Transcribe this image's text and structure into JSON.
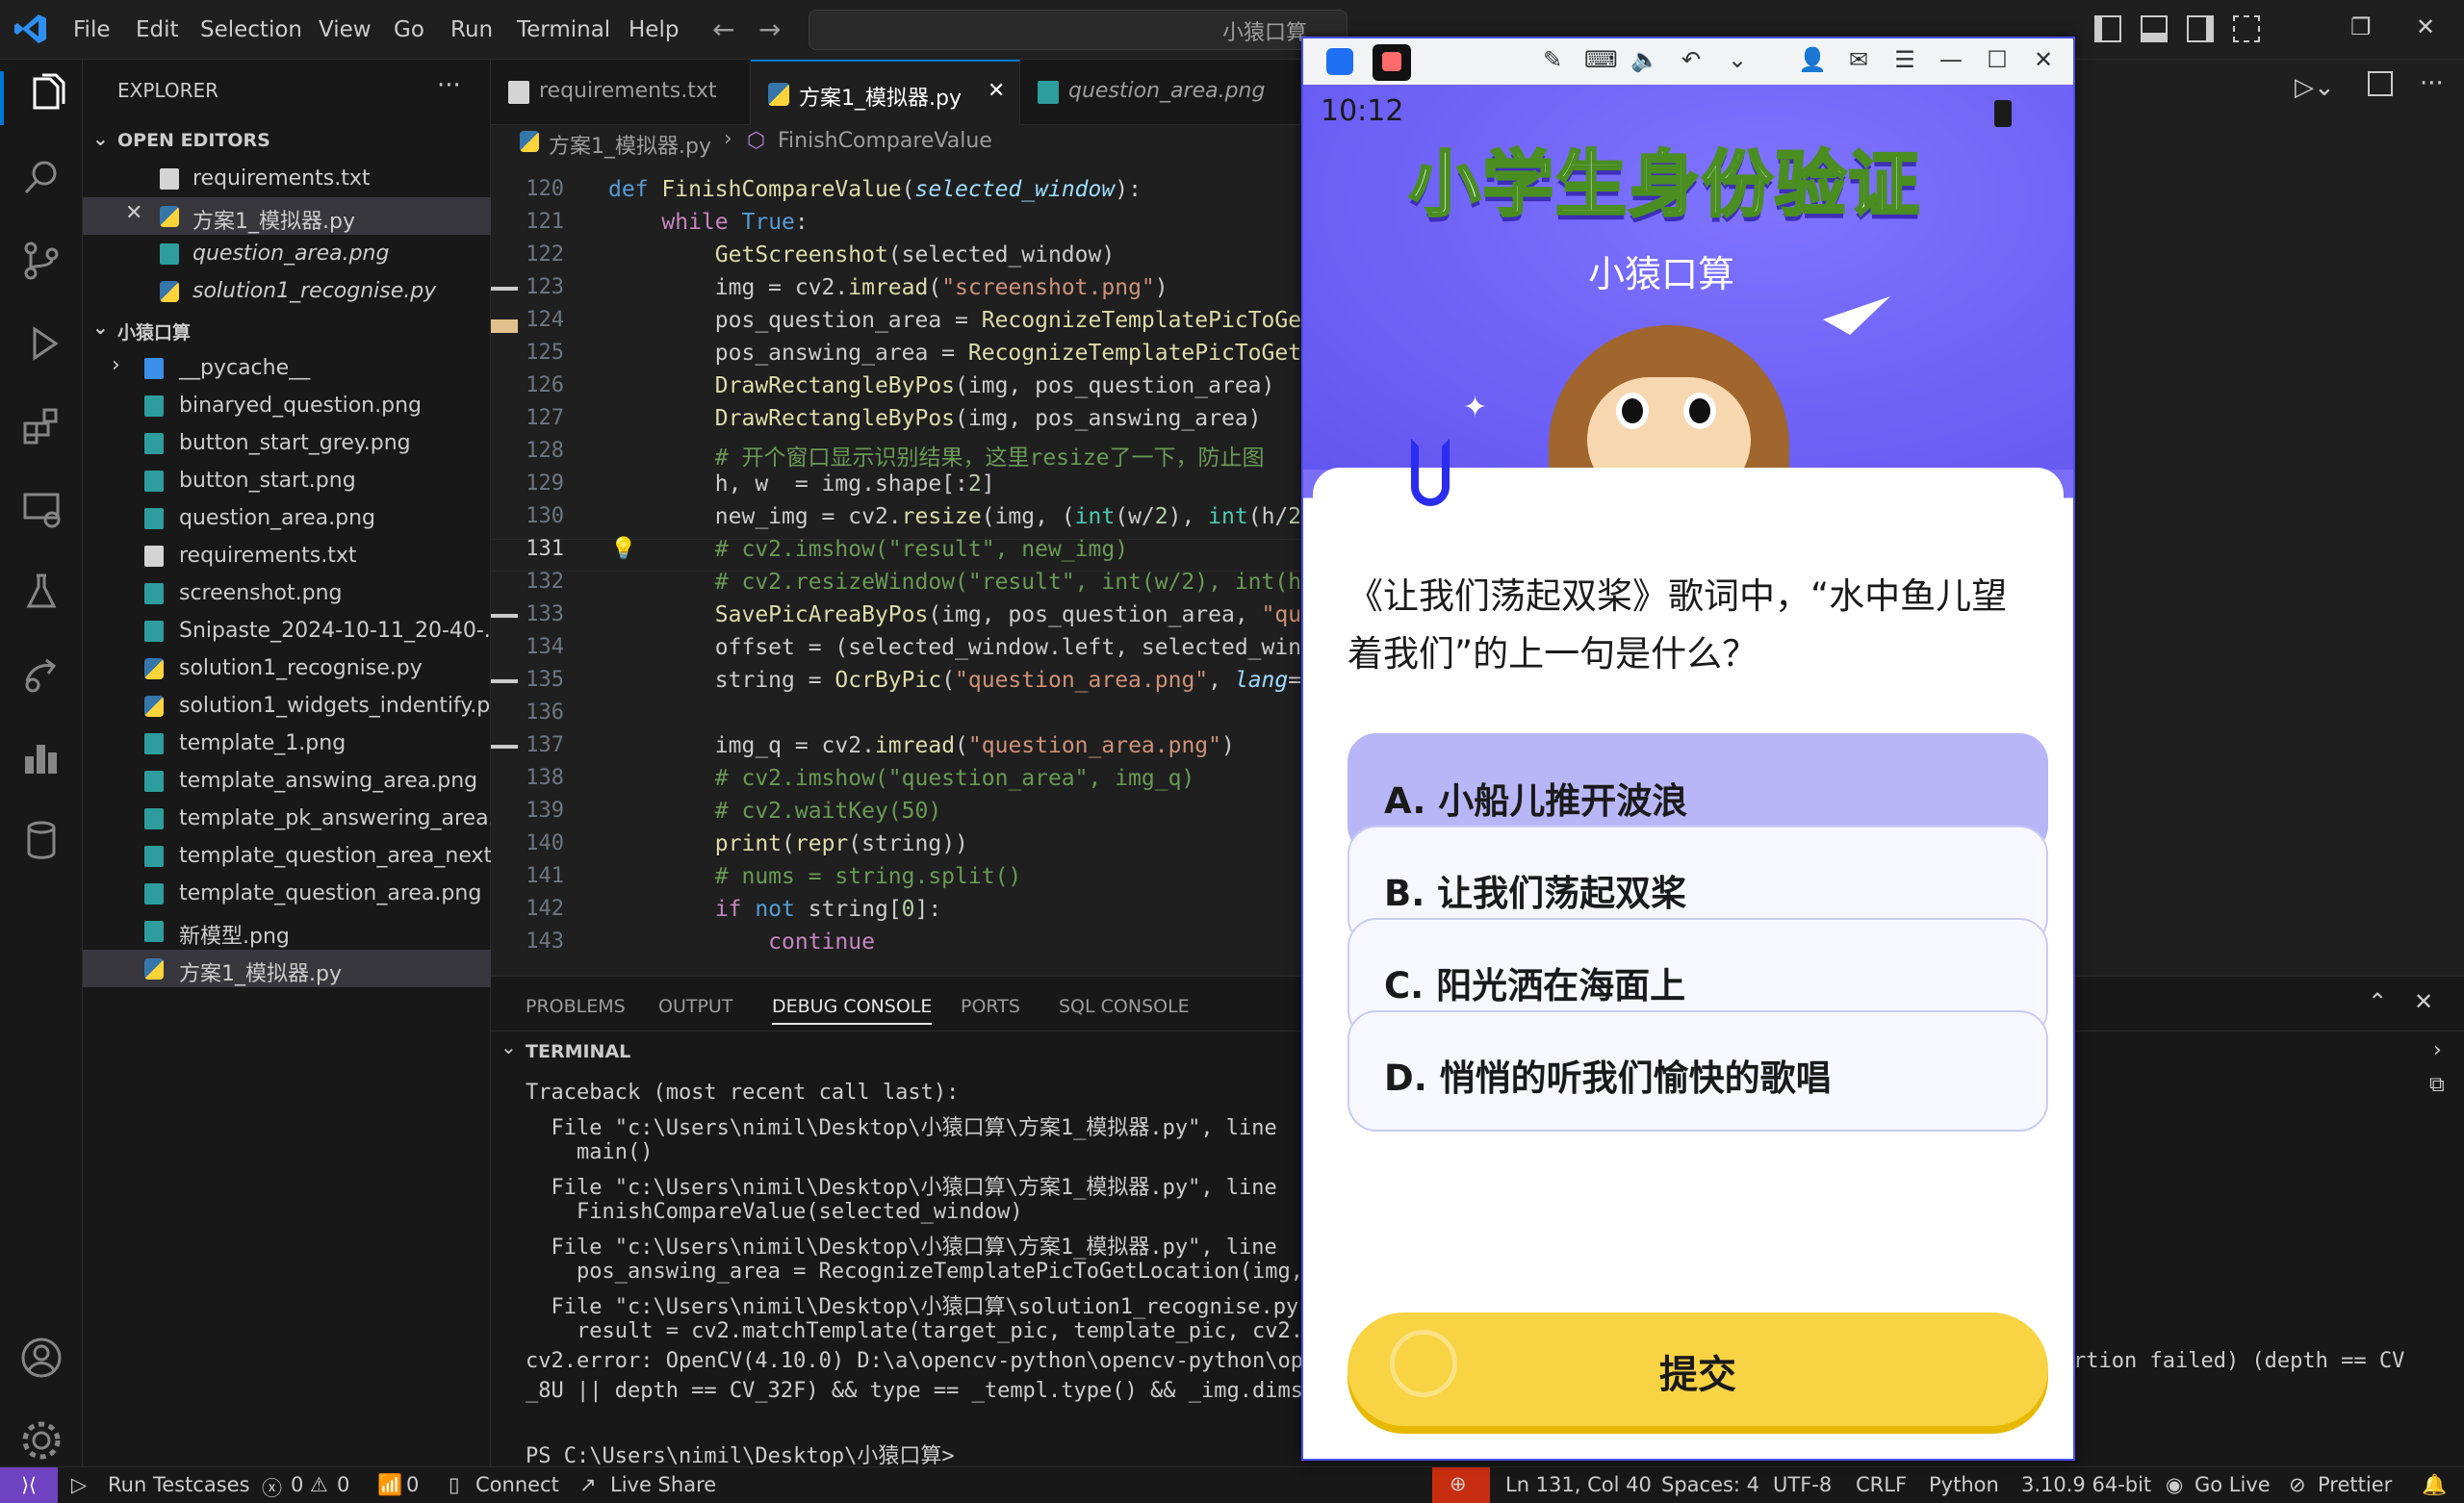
{
  "menu": [
    "File",
    "Edit",
    "Selection",
    "View",
    "Go",
    "Run",
    "Terminal",
    "Help"
  ],
  "search": {
    "text": "小猿口算"
  },
  "explorer": {
    "title": "EXPLORER",
    "open_editors_label": "OPEN EDITORS",
    "open_editors": [
      "requirements.txt",
      "方案1_模拟器.py",
      "question_area.png",
      "solution1_recognise.py"
    ],
    "folder_label": "小猿口算",
    "files": [
      "__pycache__",
      "binaryed_question.png",
      "button_start_grey.png",
      "button_start.png",
      "question_area.png",
      "requirements.txt",
      "screenshot.png",
      "Snipaste_2024-10-11_20-40-...",
      "solution1_recognise.py",
      "solution1_widgets_indentify.py",
      "template_1.png",
      "template_answing_area.png",
      "template_pk_answering_area....",
      "template_question_area_next....",
      "template_question_area.png",
      "新模型.png",
      "方案1_模拟器.py"
    ]
  },
  "tabs": [
    "requirements.txt",
    "方案1_模拟器.py",
    "question_area.png"
  ],
  "breadcrumb": {
    "file": "方案1_模拟器.py",
    "symbol": "FinishCompareValue"
  },
  "code": {
    "line_numbers": [
      "120",
      "121",
      "122",
      "123",
      "124",
      "125",
      "126",
      "127",
      "128",
      "129",
      "130",
      "131",
      "132",
      "133",
      "134",
      "135",
      "136",
      "137",
      "138",
      "139",
      "140",
      "141",
      "142",
      "143"
    ]
  },
  "panel": {
    "tabs": [
      "PROBLEMS",
      "OUTPUT",
      "DEBUG CONSOLE",
      "PORTS",
      "SQL CONSOLE"
    ],
    "terminal_label": "TERMINAL",
    "lines": [
      "Traceback (most recent call last):",
      "  File \"c:\\Users\\nimil\\Desktop\\小猿口算\\方案1_模拟器.py\", line",
      "    main()",
      "  File \"c:\\Users\\nimil\\Desktop\\小猿口算\\方案1_模拟器.py\", line",
      "    FinishCompareValue(selected_window)",
      "  File \"c:\\Users\\nimil\\Desktop\\小猿口算\\方案1_模拟器.py\", line",
      "    pos_answing_area = RecognizeTemplatePicToGetLocation(img,",
      "  File \"c:\\Users\\nimil\\Desktop\\小猿口算\\solution1_recognise.py",
      "    result = cv2.matchTemplate(target_pic, template_pic, cv2.T",
      "cv2.error: OpenCV(4.10.0) D:\\a\\opencv-python\\opencv-python\\ope",
      "_8U || depth == CV_32F) && type == _templ.type() && _img.dims(",
      "",
      "PS C:\\Users\\nimil\\Desktop\\小猿口算>"
    ],
    "right_fragment": "rtion failed) (depth == CV"
  },
  "status": {
    "run_testcases": "Run Testcases",
    "errors": "0",
    "warnings": "0",
    "ports": "0",
    "connect": "Connect",
    "live_share": "Live Share",
    "cursor": "Ln 131, Col 40",
    "spaces": "Spaces: 4",
    "encoding": "UTF-8",
    "eol": "CRLF",
    "language": "Python",
    "interpreter": "3.10.9 64-bit",
    "go_live": "Go Live",
    "prettier": "Prettier"
  },
  "popup": {
    "time": "10:12",
    "title": "小学生身份验证",
    "subtitle": "小猿口算",
    "question": "《让我们荡起双桨》歌词中，“水中鱼儿望着我们”的上一句是什么？",
    "options": [
      "A. 小船儿推开波浪",
      "B. 让我们荡起双桨",
      "C. 阳光洒在海面上",
      "D. 悄悄的听我们愉快的歌唱"
    ],
    "submit": "提交"
  },
  "colors": {
    "accent": "#0078d4",
    "popup_purple": "#6c5ef5",
    "selected_option": "#b8b6f7",
    "submit_yellow": "#f8d344"
  }
}
